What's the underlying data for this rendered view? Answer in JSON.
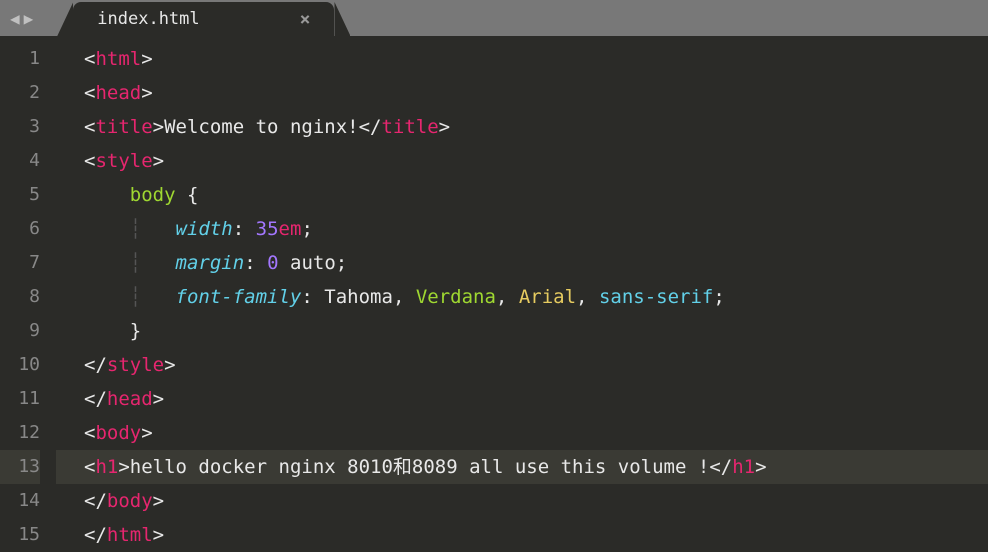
{
  "tab": {
    "filename": "index.html",
    "close_glyph": "×"
  },
  "nav": {
    "back_glyph": "◀",
    "forward_glyph": "▶"
  },
  "gutter": {
    "start": 1,
    "end": 15,
    "highlighted": 13
  },
  "code": {
    "lines": [
      {
        "tokens": [
          [
            "tag-bracket",
            "<"
          ],
          [
            "tag-name",
            "html"
          ],
          [
            "tag-bracket",
            ">"
          ]
        ]
      },
      {
        "tokens": [
          [
            "tag-bracket",
            "<"
          ],
          [
            "tag-name",
            "head"
          ],
          [
            "tag-bracket",
            ">"
          ]
        ]
      },
      {
        "tokens": [
          [
            "tag-bracket",
            "<"
          ],
          [
            "tag-name",
            "title"
          ],
          [
            "tag-bracket",
            ">"
          ],
          [
            "plain-text",
            "Welcome to nginx!"
          ],
          [
            "tag-bracket",
            "</"
          ],
          [
            "tag-name",
            "title"
          ],
          [
            "tag-bracket",
            ">"
          ]
        ]
      },
      {
        "tokens": [
          [
            "tag-bracket",
            "<"
          ],
          [
            "tag-name",
            "style"
          ],
          [
            "tag-bracket",
            ">"
          ]
        ]
      },
      {
        "tokens": [
          [
            "plain-text",
            "    "
          ],
          [
            "css-selector",
            "body"
          ],
          [
            "plain-text",
            " "
          ],
          [
            "css-punct",
            "{"
          ]
        ]
      },
      {
        "tokens": [
          [
            "plain-text",
            "    "
          ],
          [
            "indent-guide",
            "┆"
          ],
          [
            "plain-text",
            "   "
          ],
          [
            "css-prop",
            "width"
          ],
          [
            "css-punct",
            ":"
          ],
          [
            "plain-text",
            " "
          ],
          [
            "css-value-num",
            "35"
          ],
          [
            "css-value-unit",
            "em"
          ],
          [
            "css-punct",
            ";"
          ]
        ]
      },
      {
        "tokens": [
          [
            "plain-text",
            "    "
          ],
          [
            "indent-guide",
            "┆"
          ],
          [
            "plain-text",
            "   "
          ],
          [
            "css-prop",
            "margin"
          ],
          [
            "css-punct",
            ":"
          ],
          [
            "plain-text",
            " "
          ],
          [
            "css-value-num",
            "0"
          ],
          [
            "plain-text",
            " "
          ],
          [
            "css-value-auto",
            "auto"
          ],
          [
            "css-punct",
            ";"
          ]
        ]
      },
      {
        "tokens": [
          [
            "plain-text",
            "    "
          ],
          [
            "indent-guide",
            "┆"
          ],
          [
            "plain-text",
            "   "
          ],
          [
            "css-prop",
            "font-family"
          ],
          [
            "css-punct",
            ":"
          ],
          [
            "plain-text",
            " "
          ],
          [
            "css-value-font1",
            "Tahoma"
          ],
          [
            "css-punct",
            ","
          ],
          [
            "plain-text",
            " "
          ],
          [
            "css-value-font2",
            "Verdana"
          ],
          [
            "css-punct",
            ","
          ],
          [
            "plain-text",
            " "
          ],
          [
            "css-value-font3",
            "Arial"
          ],
          [
            "css-punct",
            ","
          ],
          [
            "plain-text",
            " "
          ],
          [
            "css-value-font4",
            "sans-serif"
          ],
          [
            "css-punct",
            ";"
          ]
        ]
      },
      {
        "tokens": [
          [
            "plain-text",
            "    "
          ],
          [
            "css-punct",
            "}"
          ]
        ]
      },
      {
        "tokens": [
          [
            "tag-bracket",
            "</"
          ],
          [
            "tag-name",
            "style"
          ],
          [
            "tag-bracket",
            ">"
          ]
        ]
      },
      {
        "tokens": [
          [
            "tag-bracket",
            "</"
          ],
          [
            "tag-name",
            "head"
          ],
          [
            "tag-bracket",
            ">"
          ]
        ]
      },
      {
        "tokens": [
          [
            "tag-bracket",
            "<"
          ],
          [
            "tag-name",
            "body"
          ],
          [
            "tag-bracket",
            ">"
          ]
        ]
      },
      {
        "tokens": [
          [
            "tag-bracket",
            "<"
          ],
          [
            "tag-name",
            "h1"
          ],
          [
            "tag-bracket",
            ">"
          ],
          [
            "plain-text",
            "hello docker nginx 8010和8089 all use this volume !"
          ],
          [
            "tag-bracket",
            "</"
          ],
          [
            "tag-name",
            "h1"
          ],
          [
            "tag-bracket",
            ">"
          ]
        ],
        "highlight": true
      },
      {
        "tokens": [
          [
            "tag-bracket",
            "</"
          ],
          [
            "tag-name",
            "body"
          ],
          [
            "tag-bracket",
            ">"
          ]
        ]
      },
      {
        "tokens": [
          [
            "tag-bracket",
            "</"
          ],
          [
            "tag-name",
            "html"
          ],
          [
            "tag-bracket",
            ">"
          ]
        ]
      }
    ]
  }
}
